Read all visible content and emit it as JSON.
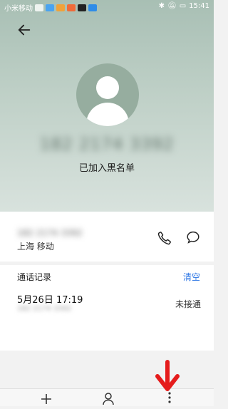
{
  "status_bar": {
    "carrier": "小米移动",
    "battery": "",
    "time": "15:41"
  },
  "contact": {
    "phone_number": "182 2174 3392",
    "status": "已加入黑名单"
  },
  "contact_info": {
    "number_small": "182 2174 3392",
    "location": "上海 移动"
  },
  "call_records": {
    "title": "通话记录",
    "clear_label": "清空",
    "items": [
      {
        "date": "5月26日 17:19",
        "sub": "182 2174 3392",
        "result": "未接通"
      }
    ]
  },
  "icons": {
    "back": "back-arrow-icon",
    "avatar": "default-avatar-icon",
    "call": "phone-icon",
    "message": "message-icon",
    "add": "plus-icon",
    "contact": "person-icon",
    "more": "more-vertical-icon",
    "annotation_arrow": "red-down-arrow-icon"
  },
  "colors": {
    "accent": "#2a74e4",
    "header_bg": "#b9cbc1",
    "annotation": "#e51c1c"
  }
}
